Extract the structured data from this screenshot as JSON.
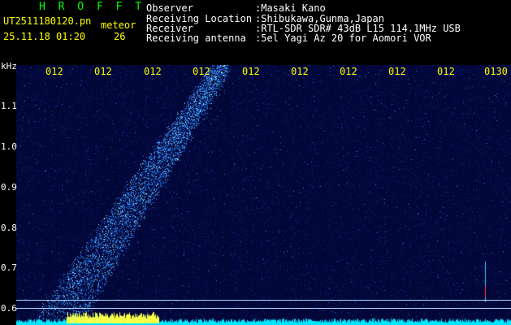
{
  "app": {
    "title": "H R O F F T"
  },
  "capture": {
    "file": "UT2511180120.pn",
    "mode": "meteor",
    "datetime": "25.11.18 01:20",
    "count": "26"
  },
  "info": {
    "observer_label": "Observer",
    "observer_value": ":Masaki Kano",
    "location_label": "Receiving Location",
    "location_value": ":Shibukawa,Gunma,Japan",
    "receiver_label": "Receiver",
    "receiver_value": ":RTL-SDR SDR# 43dB L15 114.1MHz USB",
    "antenna_label": "Receiving antenna",
    "antenna_value": ":5el Yagi Az 20 for Aomori VOR"
  },
  "y_axis": {
    "unit": "kHz",
    "ticks": [
      "1.1",
      "1.0",
      "0.9",
      "0.8",
      "0.7",
      "0.6"
    ]
  },
  "time_axis": {
    "ticks": [
      "012",
      "012",
      "012",
      "012",
      "012",
      "012",
      "012",
      "012",
      "012",
      "0130"
    ]
  },
  "colors": {
    "background": "#000000",
    "plot": "#02063a",
    "header_text": "#ffffff",
    "yellow": "#ffff00",
    "title": "#00ff00",
    "signal": "#00e5ff"
  }
}
